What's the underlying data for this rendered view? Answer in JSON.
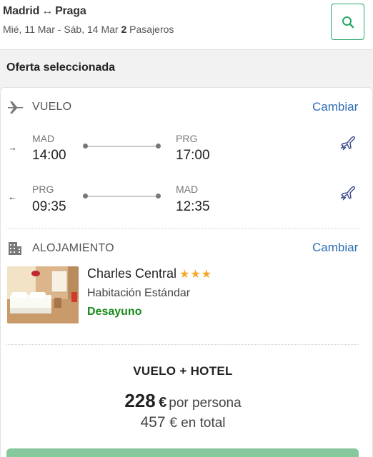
{
  "header": {
    "origin": "Madrid",
    "route_arrow": "↔",
    "destination": "Praga",
    "dates": "Mié, 11 Mar - Sáb, 14 Mar",
    "passengers_count": "2",
    "passengers_label": "Pasajeros",
    "search_icon": "search-icon"
  },
  "section_title": "Oferta seleccionada",
  "flight": {
    "label": "VUELO",
    "change": "Cambiar",
    "outbound": {
      "direction": "→",
      "from_code": "MAD",
      "from_time": "14:00",
      "to_code": "PRG",
      "to_time": "17:00"
    },
    "inbound": {
      "direction": "←",
      "from_code": "PRG",
      "from_time": "09:35",
      "to_code": "MAD",
      "to_time": "12:35"
    }
  },
  "hotel": {
    "label": "ALOJAMIENTO",
    "change": "Cambiar",
    "name": "Charles Central",
    "stars": "★★★",
    "star_count": 3,
    "room": "Habitación Estándar",
    "board": "Desayuno"
  },
  "package": {
    "title": "VUELO + HOTEL",
    "price_per_person": "228",
    "currency": "€",
    "per_person_label": "por persona",
    "total": "457",
    "total_label": "€ en total"
  },
  "colors": {
    "accent_green": "#2aa86b",
    "link_blue": "#2e6db4",
    "star": "#f5a623",
    "board_green": "#1a8a1a",
    "cta": "#86c79c"
  }
}
